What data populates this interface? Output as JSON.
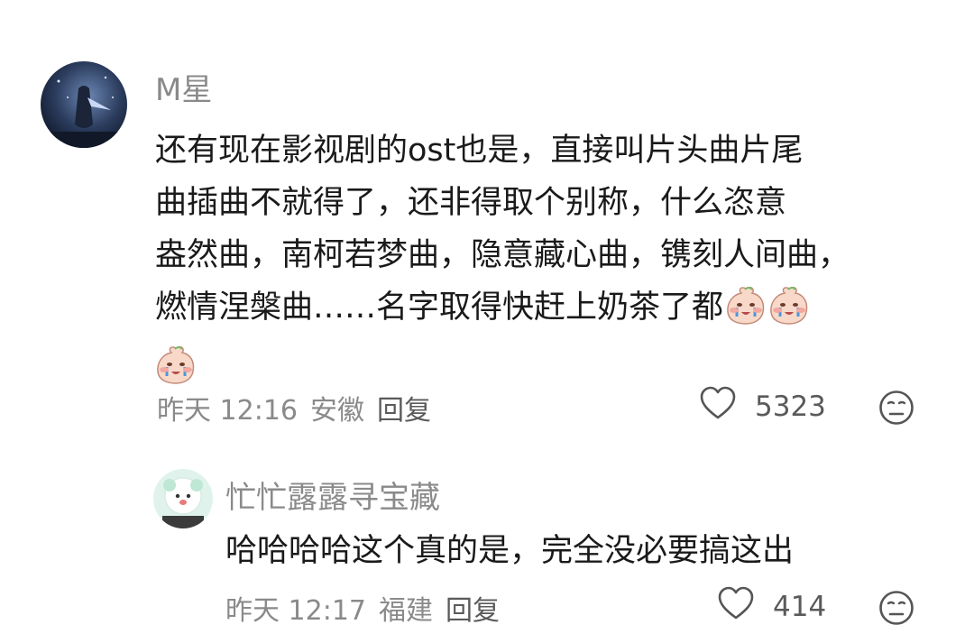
{
  "comments": [
    {
      "username": "M星",
      "lines": [
        "还有现在影视剧的ost也是，直接叫片头曲片尾",
        "曲插曲不就得了，还非得取个别称，什么恣意",
        "盎然曲，南柯若梦曲，隐意藏心曲，镌刻人间曲，",
        "燃情涅槃曲……名字取得快赶上奶茶了都"
      ],
      "time": "昨天 12:16",
      "location": "安徽",
      "reply_label": "回复",
      "likes": "5323",
      "emojis": [
        "crying-peach-emoji",
        "crying-peach-emoji",
        "crying-peach-emoji"
      ]
    },
    {
      "username": "忙忙露露寻宝藏",
      "lines": [
        "哈哈哈哈这个真的是，完全没必要搞这出"
      ],
      "time": "昨天 12:17",
      "location": "福建",
      "reply_label": "回复",
      "likes": "414"
    }
  ],
  "colors": {
    "meta_text": "#8a8a8a",
    "body_text": "#1a1a1a",
    "icon_stroke": "#555555"
  },
  "icons": {
    "like": "heart-icon",
    "dislike": "neutral-face-icon"
  }
}
